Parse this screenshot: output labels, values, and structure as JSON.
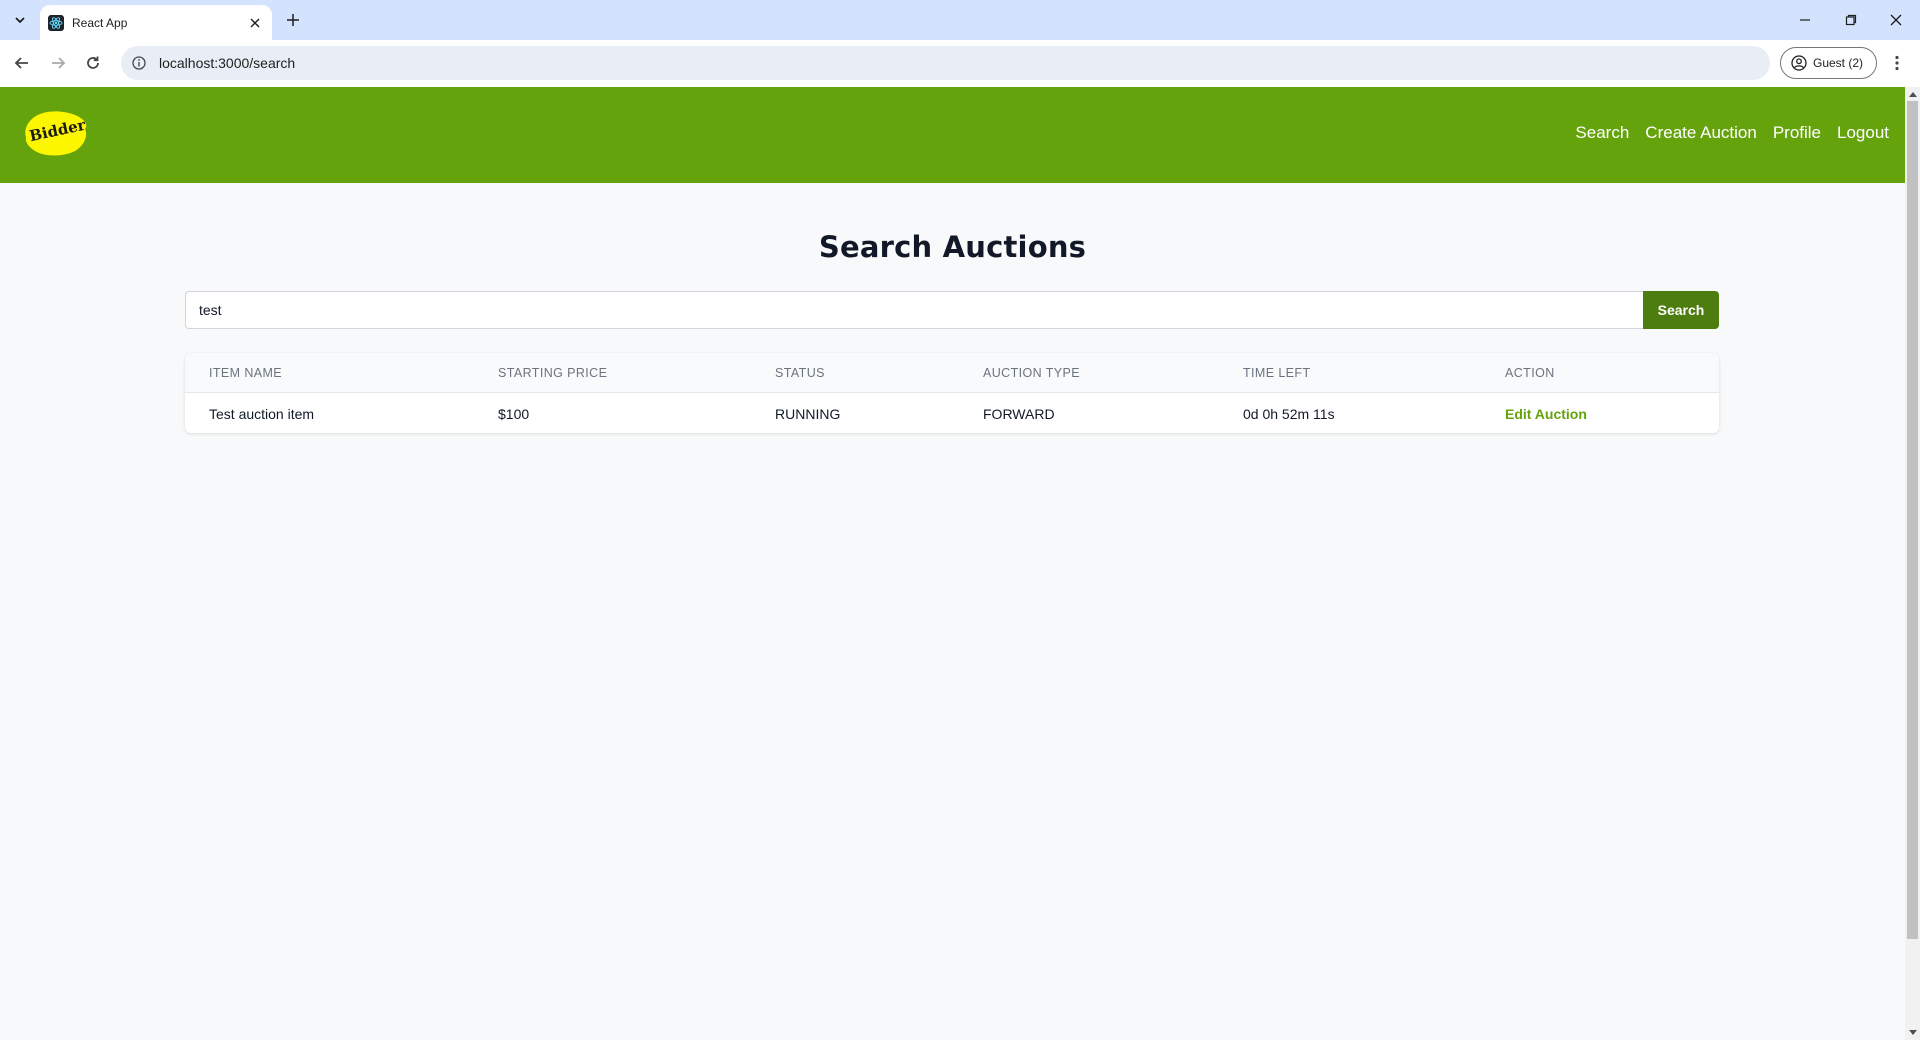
{
  "browser": {
    "tab_title": "React App",
    "url": "localhost:3000/search",
    "profile_label": "Guest (2)"
  },
  "site": {
    "logo_text": "Bidder",
    "nav": [
      "Search",
      "Create Auction",
      "Profile",
      "Logout"
    ],
    "header_color": "#65a30d",
    "logo_color": "#fcf700"
  },
  "page": {
    "title": "Search Auctions"
  },
  "search": {
    "value": "test",
    "button_label": "Search"
  },
  "table": {
    "headers": [
      "ITEM NAME",
      "STARTING PRICE",
      "STATUS",
      "AUCTION TYPE",
      "TIME LEFT",
      "ACTION"
    ],
    "rows": [
      {
        "item_name": "Test auction item",
        "starting_price": "$100",
        "status": "RUNNING",
        "auction_type": "FORWARD",
        "time_left": "0d 0h 52m 11s",
        "action": "Edit Auction"
      }
    ]
  },
  "icons": [
    "tab-search-icon",
    "react-favicon-icon",
    "close-icon",
    "plus-icon",
    "minimize-icon",
    "restore-icon",
    "window-close-icon",
    "back-arrow-icon",
    "forward-arrow-icon",
    "reload-icon",
    "site-info-icon",
    "profile-icon",
    "kebab-menu-icon"
  ]
}
